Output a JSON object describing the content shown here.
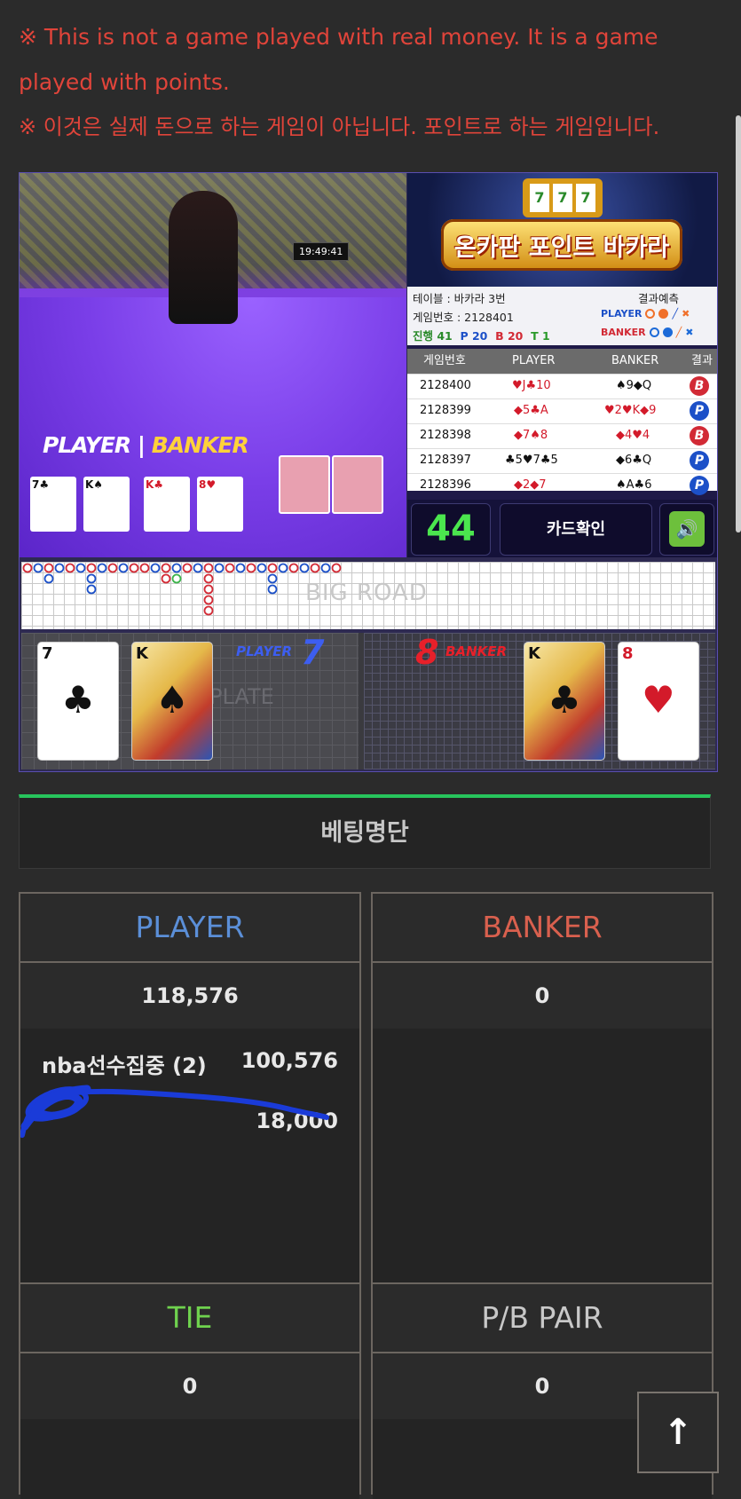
{
  "notice": {
    "english": "※ This is not a game played with real money. It is a game played with points.",
    "korean": "※ 이것은 실제 돈으로 하는 게임이 아닙니다. 포인트로 하는 게임입니다."
  },
  "video": {
    "clock": "19:49:41",
    "player_label": "PLAYER",
    "banker_label": "BANKER"
  },
  "banner": {
    "title": "온카판 포인트 바카라",
    "slot": [
      "7",
      "7",
      "7"
    ]
  },
  "meta": {
    "table": "테이블 : 바카라 3번",
    "game_no": "게임번호 : 2128401",
    "progress_label": "진행 41",
    "p_count": "P 20",
    "b_count": "B 20",
    "t_count": "T 1",
    "predict_label": "결과예측",
    "predict_player": "PLAYER",
    "predict_banker": "BANKER",
    "colors": {
      "player": "#1c50c8",
      "banker": "#d22a35"
    }
  },
  "history": {
    "headers": [
      "게임번호",
      "PLAYER",
      "BANKER",
      "결과"
    ],
    "rows": [
      {
        "no": "2128400",
        "player": "♥J♣10",
        "banker": "♠9◆Q",
        "result": "B"
      },
      {
        "no": "2128399",
        "player": "◆5♣A",
        "banker": "♥2♥K◆9",
        "result": "P"
      },
      {
        "no": "2128398",
        "player": "◆7♠8",
        "banker": "◆4♥4",
        "result": "B"
      },
      {
        "no": "2128397",
        "player": "♣5♥7♣5",
        "banker": "◆6♣Q",
        "result": "P"
      },
      {
        "no": "2128396",
        "player": "◆2◆7",
        "banker": "♠A♣6",
        "result": "P"
      }
    ]
  },
  "controls": {
    "countdown": "44",
    "confirm": "카드확인",
    "sound_icon": "speaker-icon"
  },
  "road": {
    "bigroad": "BIG ROAD",
    "plate": "PLATE"
  },
  "result": {
    "player_label": "PLAYER",
    "player_score": "7",
    "banker_label": "BANKER",
    "banker_score": "8",
    "player_cards": [
      {
        "rank": "7",
        "suit": "♣"
      },
      {
        "rank": "K",
        "suit": "♠"
      }
    ],
    "banker_cards": [
      {
        "rank": "K",
        "suit": "♣"
      },
      {
        "rank": "8",
        "suit": "♥"
      }
    ]
  },
  "betting": {
    "header": "베팅명단",
    "player": {
      "title": "PLAYER",
      "total": "118,576",
      "bettors": [
        {
          "name": "nba선수집중 (2)",
          "amount": "100,576"
        },
        {
          "name": "",
          "amount": "18,000"
        }
      ]
    },
    "banker": {
      "title": "BANKER",
      "total": "0"
    },
    "tie": {
      "title": "TIE",
      "total": "0"
    },
    "pair": {
      "title": "P/B PAIR",
      "total": "0"
    }
  },
  "scroll_top_icon": "arrow-up-icon"
}
